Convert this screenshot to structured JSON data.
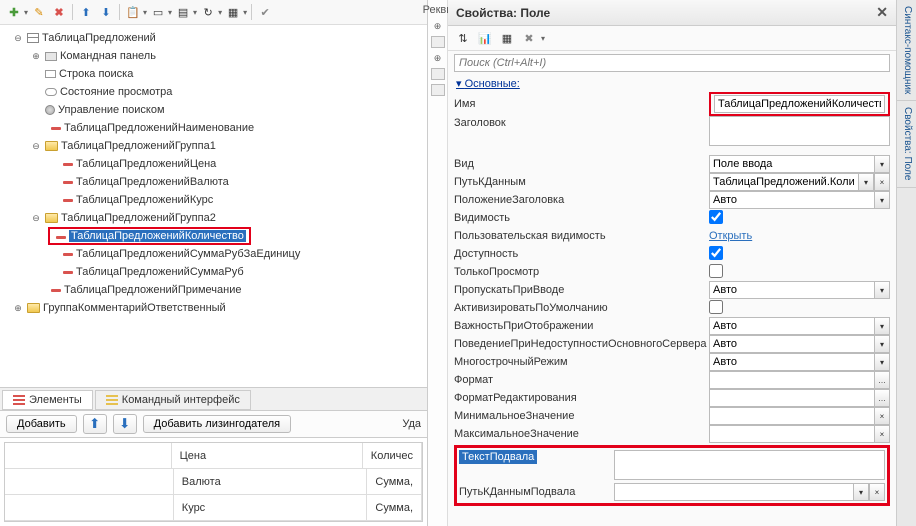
{
  "panel_title": "Свойства: Поле",
  "search_placeholder": "Поиск (Ctrl+Alt+I)",
  "section_main": "Основные:",
  "side_tabs": {
    "syntax": "Синтакс-помощник",
    "props": "Свойства: Поле"
  },
  "left_sliver": {
    "req": "Рекви"
  },
  "tree": {
    "root": "ТаблицаПредложений",
    "cmd_panel": "Командная панель",
    "search_row": "Строка поиска",
    "view_state": "Состояние просмотра",
    "search_ctrl": "Управление поиском",
    "name_col": "ТаблицаПредложенийНаименование",
    "group1": "ТаблицаПредложенийГруппа1",
    "price": "ТаблицаПредложенийЦена",
    "currency": "ТаблицаПредложенийВалюта",
    "rate": "ТаблицаПредложенийКурс",
    "group2": "ТаблицаПредложенийГруппа2",
    "qty": "ТаблицаПредложенийКоличество",
    "sum_unit": "ТаблицаПредложенийСуммаРубЗаЕдиницу",
    "sum": "ТаблицаПредложенийСуммаРуб",
    "note": "ТаблицаПредложенийПримечание",
    "group_comment": "ГруппаКомментарийОтветственный"
  },
  "bottom_tabs": {
    "elements": "Элементы",
    "cmd_iface": "Командный интерфейс"
  },
  "form_bar": {
    "add": "Добавить",
    "add_lessor": "Добавить лизингодателя",
    "delete": "Уда"
  },
  "grid": {
    "h_price": "Цена",
    "h_qty": "Количес",
    "r_currency": "Валюта",
    "r_sum1": "Сумма,",
    "r_rate": "Курс",
    "r_sum2": "Сумма,"
  },
  "props": {
    "name_l": "Имя",
    "name_v": "ТаблицаПредложенийКоличество",
    "title_l": "Заголовок",
    "kind_l": "Вид",
    "kind_v": "Поле ввода",
    "path_l": "ПутьКДанным",
    "path_v": "ТаблицаПредложений.Количес",
    "title_pos_l": "ПоложениеЗаголовка",
    "title_pos_v": "Авто",
    "visible_l": "Видимость",
    "user_vis_l": "Пользовательская видимость",
    "user_vis_v": "Открыть",
    "avail_l": "Доступность",
    "readonly_l": "ТолькоПросмотр",
    "skip_l": "ПропускатьПриВводе",
    "skip_v": "Авто",
    "activate_l": "АктивизироватьПоУмолчанию",
    "importance_l": "ВажностьПриОтображении",
    "importance_v": "Авто",
    "unavail_l": "ПоведениеПриНедоступностиОсновногоСервера",
    "unavail_v": "Авто",
    "multiline_l": "МногострочныйРежим",
    "multiline_v": "Авто",
    "format_l": "Формат",
    "edit_format_l": "ФорматРедактирования",
    "min_l": "МинимальноеЗначение",
    "max_l": "МаксимальноеЗначение",
    "footer_text_l": "ТекстПодвала",
    "footer_path_l": "ПутьКДаннымПодвала"
  }
}
